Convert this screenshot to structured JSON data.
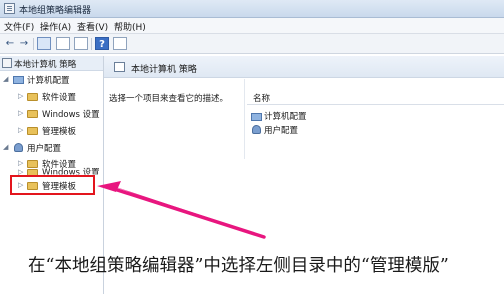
{
  "window": {
    "title": "本地组策略编辑器"
  },
  "menu": [
    {
      "label": "文件(F)"
    },
    {
      "label": "操作(A)"
    },
    {
      "label": "查看(V)"
    },
    {
      "label": "帮助(H)"
    }
  ],
  "toolbar": {
    "back_icon": "←",
    "forward_icon": "→",
    "help_icon": "?"
  },
  "tree": {
    "root": "本地计算机 策略",
    "computer": "计算机配置",
    "computer_children": [
      "软件设置",
      "Windows 设置",
      "管理模板"
    ],
    "user": "用户配置",
    "user_children": [
      "软件设置",
      "Windows 设置",
      "管理模板"
    ]
  },
  "main": {
    "title": "本地计算机 策略",
    "description": "选择一个项目来查看它的描述。",
    "column_name": "名称",
    "rows": [
      "计算机配置",
      "用户配置"
    ]
  },
  "caption": "在“本地组策略编辑器”中选择左侧目录中的“管理模版”",
  "colors": {
    "highlight": "#e3151d",
    "arrow": "#e8167f"
  }
}
